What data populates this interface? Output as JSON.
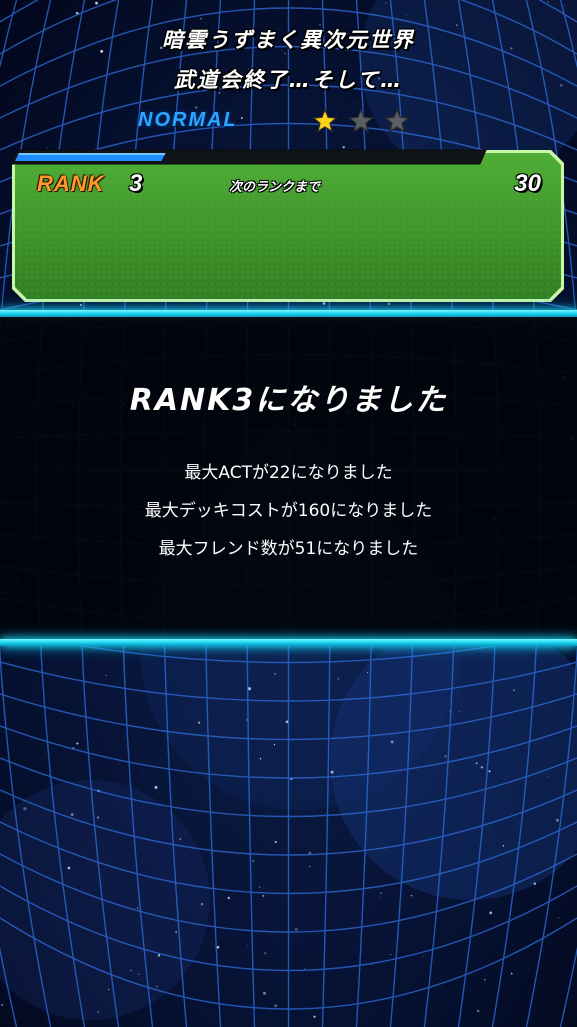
{
  "stage": {
    "title_line1": "暗雲うずまく異次元世界",
    "title_line2": "武道会終了…そして…",
    "difficulty": "NORMAL",
    "stars_filled": 1,
    "stars_total": 3,
    "star_on_color": "#ffd21a",
    "star_off_color": "#5a5f66"
  },
  "rank": {
    "label": "RANK",
    "value": "3",
    "next_label": "次のランクまで",
    "next_value": "30",
    "progress": 0.32,
    "panel_color": "#3f9a2c",
    "bar_color": "#1f8fff"
  },
  "result": {
    "title": "RANK3になりました",
    "bonuses": [
      "最大ACTが22になりました",
      "最大デッキコストが160になりました",
      "最大フレンド数が51になりました"
    ],
    "accent_color": "#19d6f0"
  }
}
